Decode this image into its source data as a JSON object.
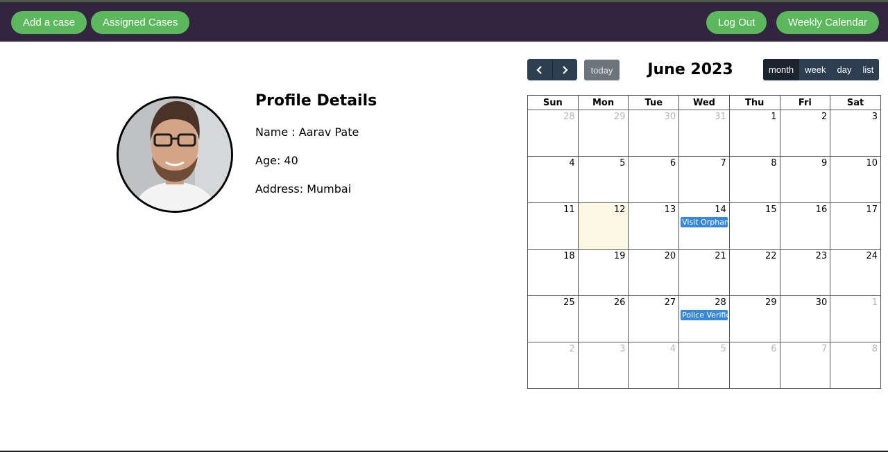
{
  "nav": {
    "add_case": "Add a case",
    "assigned_cases": "Assigned Cases",
    "log_out": "Log Out",
    "weekly_calendar": "Weekly Calendar"
  },
  "colors": {
    "topbar": "#33253f",
    "pill": "#5cb85c",
    "toolbar": "#2c3e50",
    "event": "#3788d8",
    "today_cell": "#fcf8e3"
  },
  "profile": {
    "title": "Profile Details",
    "name_line": "Name : Aarav Pate",
    "age_line": "Age: 40",
    "address_line": "Address: Mumbai"
  },
  "calendar": {
    "title": "June 2023",
    "today_label": "today",
    "prev_icon": "chevron-left-icon",
    "next_icon": "chevron-right-icon",
    "views": [
      "month",
      "week",
      "day",
      "list"
    ],
    "active_view": "month",
    "weekdays": [
      "Sun",
      "Mon",
      "Tue",
      "Wed",
      "Thu",
      "Fri",
      "Sat"
    ],
    "weeks": [
      [
        {
          "d": "28",
          "other": true
        },
        {
          "d": "29",
          "other": true
        },
        {
          "d": "30",
          "other": true
        },
        {
          "d": "31",
          "other": true
        },
        {
          "d": "1"
        },
        {
          "d": "2"
        },
        {
          "d": "3"
        }
      ],
      [
        {
          "d": "4"
        },
        {
          "d": "5"
        },
        {
          "d": "6"
        },
        {
          "d": "7"
        },
        {
          "d": "8"
        },
        {
          "d": "9"
        },
        {
          "d": "10"
        }
      ],
      [
        {
          "d": "11"
        },
        {
          "d": "12",
          "today": true
        },
        {
          "d": "13"
        },
        {
          "d": "14",
          "event": "Visit Orphana"
        },
        {
          "d": "15"
        },
        {
          "d": "16"
        },
        {
          "d": "17"
        }
      ],
      [
        {
          "d": "18"
        },
        {
          "d": "19"
        },
        {
          "d": "20"
        },
        {
          "d": "21"
        },
        {
          "d": "22"
        },
        {
          "d": "23"
        },
        {
          "d": "24"
        }
      ],
      [
        {
          "d": "25"
        },
        {
          "d": "26"
        },
        {
          "d": "27"
        },
        {
          "d": "28",
          "event": "Police Verifica"
        },
        {
          "d": "29"
        },
        {
          "d": "30"
        },
        {
          "d": "1",
          "other": true
        }
      ],
      [
        {
          "d": "2",
          "other": true
        },
        {
          "d": "3",
          "other": true
        },
        {
          "d": "4",
          "other": true
        },
        {
          "d": "5",
          "other": true
        },
        {
          "d": "6",
          "other": true
        },
        {
          "d": "7",
          "other": true
        },
        {
          "d": "8",
          "other": true
        }
      ]
    ]
  }
}
